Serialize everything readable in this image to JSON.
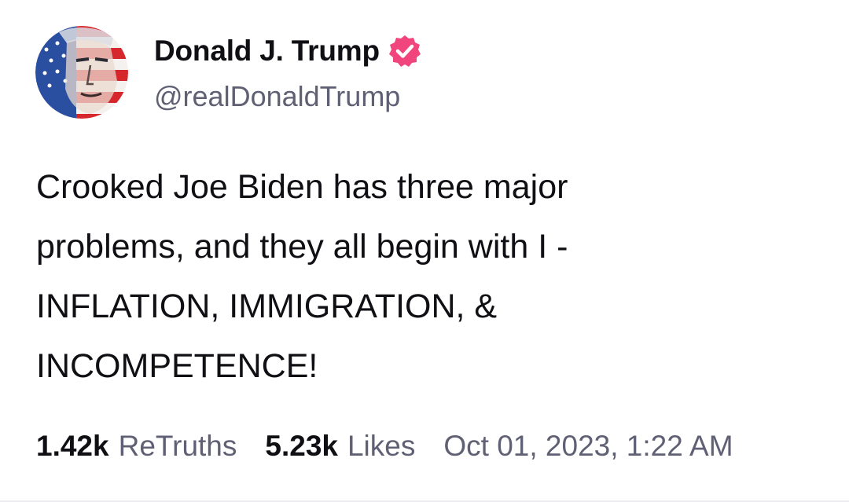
{
  "author": {
    "display_name": "Donald J. Trump",
    "handle": "@realDonaldTrump",
    "verified": true,
    "verified_color": "#f0457d"
  },
  "post": {
    "text": "Crooked Joe Biden has three major\nproblems, and they all begin with I -\nINFLATION, IMMIGRATION, &\nINCOMPETENCE!"
  },
  "stats": {
    "retruths_count": "1.42k",
    "retruths_label": "ReTruths",
    "likes_count": "5.23k",
    "likes_label": "Likes",
    "timestamp": "Oct 01, 2023, 1:22 AM"
  },
  "icons": {
    "avatar": "avatar-portrait-flag",
    "verified": "verified-badge-icon"
  }
}
